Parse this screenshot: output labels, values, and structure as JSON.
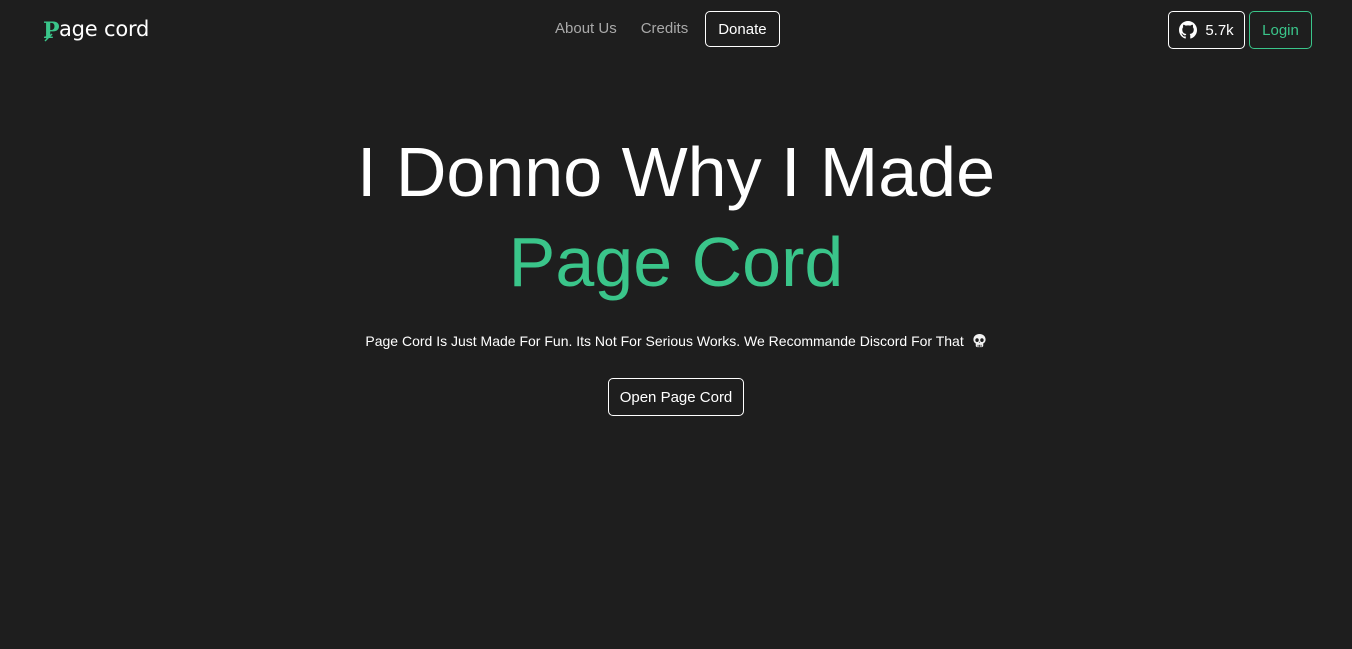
{
  "brand": {
    "name": "age cord",
    "mark_letter": "P",
    "accent_color": "#3ac58a",
    "logo_icon": "feather-icon"
  },
  "nav": {
    "links": [
      {
        "label": "About Us"
      },
      {
        "label": "Credits"
      }
    ],
    "donate_label": "Donate"
  },
  "header_actions": {
    "github_icon": "github-icon",
    "github_stars": "5.7k",
    "login_label": "Login"
  },
  "hero": {
    "title": "I Donno Why I Made",
    "accent": "Page Cord",
    "subtitle": "Page Cord Is Just Made For Fun. Its Not For Serious Works. We Recommande Discord For That",
    "subtitle_icon": "skull-icon",
    "cta_label": "Open Page Cord"
  },
  "colors": {
    "background": "#1e1e1e",
    "text": "#ffffff",
    "muted": "#a9a9a9",
    "accent": "#3ac58a"
  }
}
